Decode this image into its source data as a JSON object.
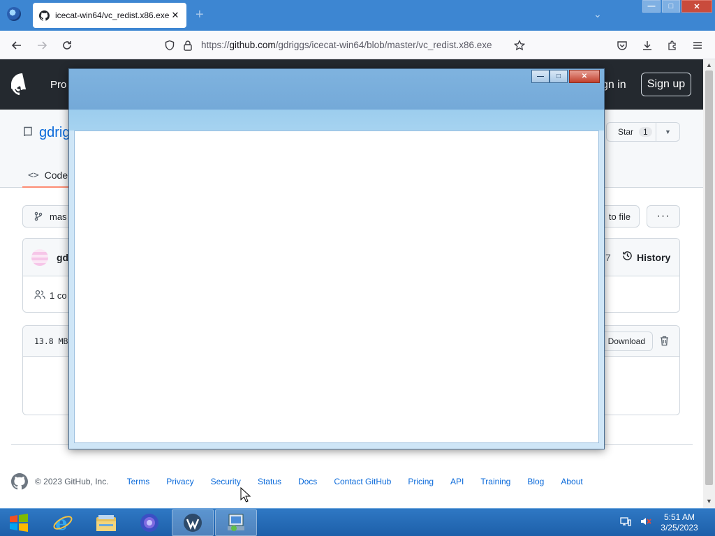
{
  "browser": {
    "tab": {
      "title": "icecat-win64/vc_redist.x86.exe a",
      "close": "✕"
    },
    "new_tab": "+",
    "tab_list": "⌄",
    "window_controls": {
      "minimize": "—",
      "maximize": "□",
      "close": "✕"
    },
    "url": {
      "prefix": "https://",
      "host": "github.com",
      "path": "/gdriggs/icecat-win64/blob/master/vc_redist.x86.exe"
    }
  },
  "github": {
    "header": {
      "product_menu": "Pro",
      "sign_in": "gn in",
      "sign_up": "Sign up"
    },
    "repo": {
      "owner_partial": "gdrig",
      "star_label": "Star",
      "star_count": "1",
      "code_tab": "Code"
    },
    "branch_partial": "mas",
    "go_to_file_partial": "to file",
    "more_label": "···",
    "commit": {
      "author_partial": "gd",
      "count_partial": "7",
      "history_label": "History",
      "contributors_partial": "1 co"
    },
    "file": {
      "size_partial": "13.8 MB",
      "download_label": "Download"
    },
    "footer": {
      "copyright": "© 2023 GitHub, Inc.",
      "links": [
        "Terms",
        "Privacy",
        "Security",
        "Status",
        "Docs",
        "Contact GitHub",
        "Pricing",
        "API",
        "Training",
        "Blog",
        "About"
      ]
    }
  },
  "overlay_window": {
    "controls": {
      "minimize": "—",
      "maximize": "□",
      "close": "✕"
    }
  },
  "taskbar": {
    "items": [
      "internet-explorer",
      "file-explorer",
      "icecat-browser",
      "app-shell",
      "installer"
    ],
    "clock": {
      "time": "5:51 AM",
      "date": "3/25/2023"
    }
  },
  "colors": {
    "tabbar": "#3d86d2",
    "github_header": "#24292f",
    "link": "#0969da",
    "taskbar": "#1d5fa9"
  }
}
